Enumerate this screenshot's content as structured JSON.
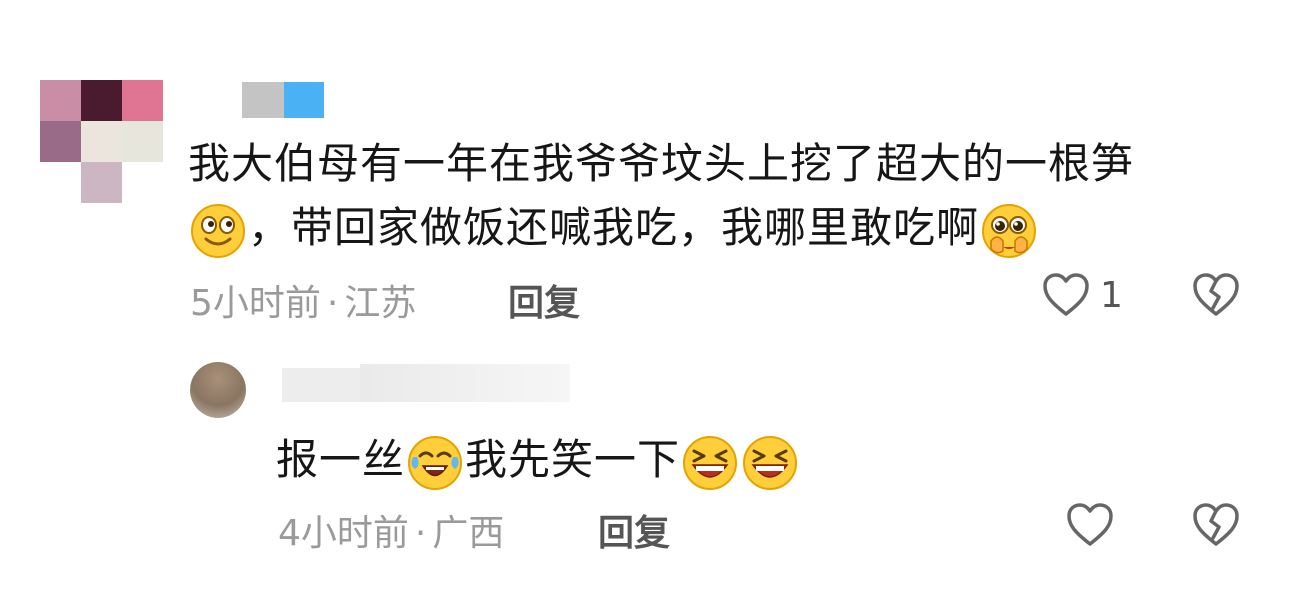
{
  "comments": [
    {
      "text_line1": "我大伯母有一年在我爷爷坟头上挖了超大的一根笋",
      "text_line2_a": "，带回家做饭还喊我吃，我哪里敢吃啊",
      "emoji_1": "smirk-face-icon",
      "emoji_2": "holding-back-tears-icon",
      "time": "5小时前",
      "separator": "·",
      "location": "江苏",
      "reply_label": "回复",
      "like_count": "1"
    },
    {
      "text_a": "报一丝",
      "text_b": "我先笑一下",
      "emoji_1": "crying-laughing-icon",
      "emoji_2": "grinning-squint-icon",
      "emoji_3": "grinning-squint-icon",
      "time": "4小时前",
      "separator": "·",
      "location": "广西",
      "reply_label": "回复"
    }
  ],
  "colors": {
    "text": "#161616",
    "meta": "#9a9a9a",
    "icon_stroke": "#666666"
  }
}
